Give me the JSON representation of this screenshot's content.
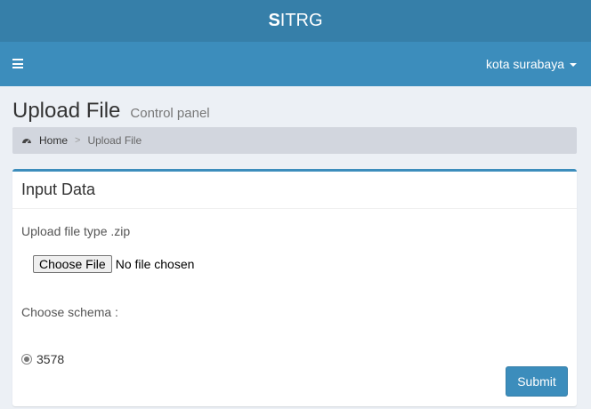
{
  "logo": {
    "bold": "S",
    "rest": "ITRG"
  },
  "navbar": {
    "user_name": "kota surabaya",
    "icons": {
      "menu": "hamburger-icon",
      "dropdown": "caret-down-icon"
    }
  },
  "page": {
    "title": "Upload File",
    "subtitle": "Control panel"
  },
  "breadcrumb": {
    "home_icon": "dashboard-icon",
    "home": "Home",
    "separator": ">",
    "current": "Upload File"
  },
  "box": {
    "title": "Input Data",
    "upload_label": "Upload file type .zip",
    "file_button": "Choose File",
    "file_status": "No file chosen",
    "schema_label": "Choose schema :",
    "schema_option": "3578",
    "submit": "Submit"
  },
  "colors": {
    "header_dark": "#367fa9",
    "header": "#3c8dbc",
    "background": "#ecf0f5",
    "breadcrumb_bg": "#d2d6de"
  }
}
